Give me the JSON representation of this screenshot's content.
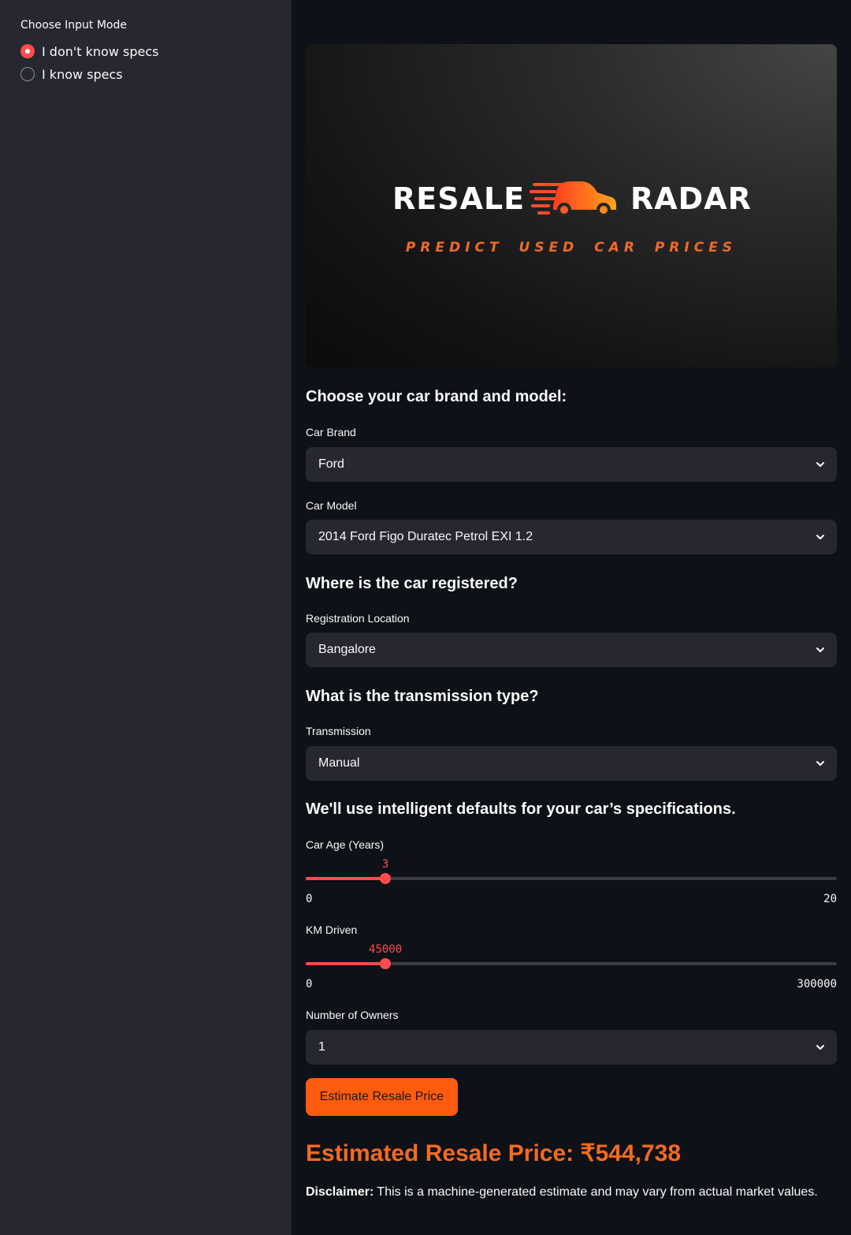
{
  "sidebar": {
    "label": "Choose Input Mode",
    "options": [
      {
        "label": "I don't know specs",
        "checked": true
      },
      {
        "label": "I know specs",
        "checked": false
      }
    ]
  },
  "banner": {
    "logo_left": "RESALE",
    "logo_right": "RADAR",
    "tagline": "PREDICT USED CAR PRICES",
    "logo_icon": "speeding-car-icon"
  },
  "sections": {
    "brand_model": "Choose your car brand and model:",
    "registration": "Where is the car registered?",
    "transmission": "What is the transmission type?",
    "defaults": "We'll use intelligent defaults for your car’s specifications."
  },
  "fields": {
    "car_brand": {
      "label": "Car Brand",
      "value": "Ford"
    },
    "car_model": {
      "label": "Car Model",
      "value": "2014 Ford Figo Duratec Petrol EXI 1.2"
    },
    "registration_location": {
      "label": "Registration Location",
      "value": "Bangalore"
    },
    "transmission": {
      "label": "Transmission",
      "value": "Manual"
    },
    "owners": {
      "label": "Number of Owners",
      "value": "1"
    }
  },
  "sliders": {
    "car_age": {
      "label": "Car Age (Years)",
      "value": 3,
      "min": 0,
      "max": 20,
      "display_min": "0",
      "display_max": "20",
      "display_value": "3"
    },
    "km_driven": {
      "label": "KM Driven",
      "value": 45000,
      "min": 0,
      "max": 300000,
      "display_min": "0",
      "display_max": "300000",
      "display_value": "45000"
    }
  },
  "action": {
    "button_label": "Estimate Resale Price"
  },
  "result": {
    "text": "Estimated Resale Price: ₹544,738",
    "disclaimer_bold": "Disclaimer:",
    "disclaimer_text": " This is a machine-generated estimate and may vary from actual market values."
  },
  "colors": {
    "accent": "#ff4b4b",
    "brand_orange": "#f46a1f",
    "button": "#ff5b0f",
    "background": "#0e1117",
    "sidebar": "#262730"
  }
}
